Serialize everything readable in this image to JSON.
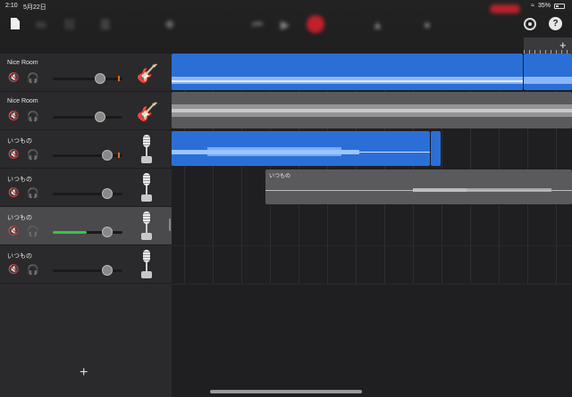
{
  "status_bar": {
    "time": "2:10",
    "date": "5月22日",
    "battery": "35%"
  },
  "toolbar": {
    "add_track": "+",
    "help": "?"
  },
  "tracks": [
    {
      "name": "Nice Room",
      "instrument": "guitar",
      "muted_style": "off",
      "volume": 0.68,
      "selected": false,
      "meter": true
    },
    {
      "name": "Nice Room",
      "instrument": "guitar",
      "muted_style": "on",
      "volume": 0.68,
      "selected": false,
      "meter": false
    },
    {
      "name": "いつもの",
      "instrument": "mic",
      "muted_style": "off",
      "volume": 0.78,
      "selected": false,
      "meter": true
    },
    {
      "name": "いつもの",
      "instrument": "mic",
      "muted_style": "on",
      "volume": 0.78,
      "selected": false,
      "meter": false
    },
    {
      "name": "いつもの",
      "instrument": "mic",
      "muted_style": "off",
      "volume": 0.78,
      "selected": true,
      "meter": false
    },
    {
      "name": "いつもの",
      "instrument": "mic",
      "muted_style": "on",
      "volume": 0.78,
      "selected": false,
      "meter": false
    }
  ],
  "sidebar": {
    "add_label": "+"
  },
  "regions": [
    {
      "label": "いつもの",
      "color": "grey"
    }
  ],
  "colors": {
    "region_blue": "#2b6fd6",
    "region_grey": "#5a5a5c",
    "record": "#c0202a",
    "meter_green": "#39c24a"
  }
}
